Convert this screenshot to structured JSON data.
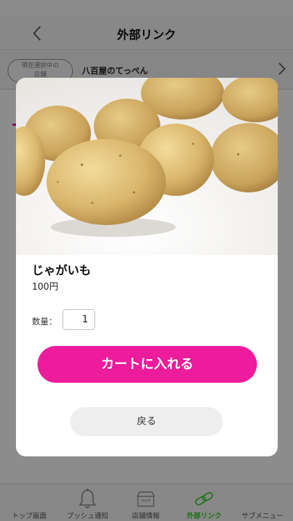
{
  "nav": {
    "title": "外部リンク"
  },
  "store_bar": {
    "pill_line1": "現在選択中の",
    "pill_line2": "店舗",
    "name": "八百屋のてっぺん"
  },
  "product": {
    "name": "じゃがいも",
    "price": "100円"
  },
  "quantity": {
    "label": "数量：",
    "value": "1"
  },
  "buttons": {
    "add_to_cart": "カートに入れる",
    "back": "戻る"
  },
  "tabs": [
    {
      "label": "トップ画面",
      "icon": "home-icon"
    },
    {
      "label": "プッシュ通知",
      "icon": "bell-icon"
    },
    {
      "label": "店舗情報",
      "icon": "shop-icon",
      "icon_text": "SHOP"
    },
    {
      "label": "外部リンク",
      "icon": "link-icon",
      "active": true
    },
    {
      "label": "サブメニュー",
      "icon": "menu-icon"
    }
  ],
  "colors": {
    "accent_pink": "#ec1c9c",
    "active_tab": "#2ecc1f"
  }
}
